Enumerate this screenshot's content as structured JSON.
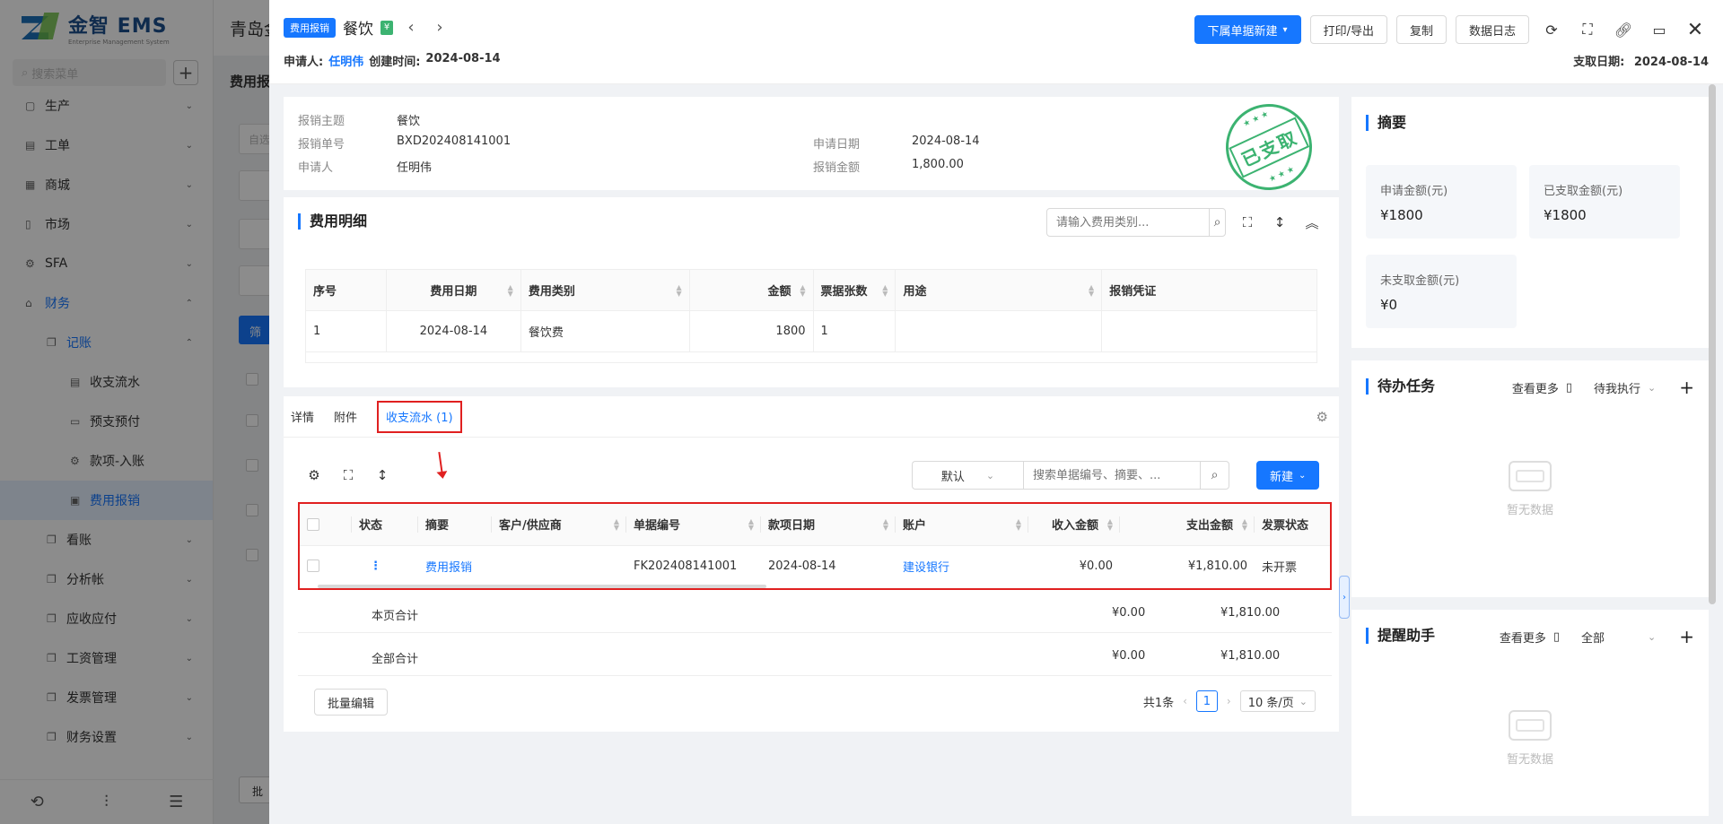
{
  "background": {
    "logo_title": "金智 EMS",
    "logo_sub": "Enterprise Management System",
    "search_placeholder": "搜索菜单",
    "header_text": "青岛金",
    "main_title": "费用报",
    "filter_btn": "筛",
    "batch_btn": "批",
    "select_placeholder": "自选",
    "nav": [
      {
        "label": "生产"
      },
      {
        "label": "工单"
      },
      {
        "label": "商城"
      },
      {
        "label": "市场"
      },
      {
        "label": "SFA"
      },
      {
        "label": "财务"
      },
      {
        "label": "记账"
      },
      {
        "label": "收支流水"
      },
      {
        "label": "预支预付"
      },
      {
        "label": "款项-入账"
      },
      {
        "label": "费用报销"
      },
      {
        "label": "看账"
      },
      {
        "label": "分析帐"
      },
      {
        "label": "应收应付"
      },
      {
        "label": "工资管理"
      },
      {
        "label": "发票管理"
      },
      {
        "label": "财务设置"
      }
    ]
  },
  "header": {
    "doc_type_tag": "费用报销",
    "title": "餐饮",
    "green_tag": "¥",
    "applicant_label": "申请人:",
    "applicant": "任明伟",
    "created_label": "创建时间:",
    "created": "2024-08-14",
    "pay_date_label": "支取日期:",
    "pay_date": "2024-08-14",
    "buttons": {
      "new_sub": "下属单据新建",
      "print": "打印/导出",
      "copy": "复制",
      "log": "数据日志"
    }
  },
  "info": {
    "subject_label": "报销主题",
    "subject": "餐饮",
    "no_label": "报销单号",
    "no": "BXD202408141001",
    "applicant_label": "申请人",
    "applicant": "任明伟",
    "apply_date_label": "申请日期",
    "apply_date": "2024-08-14",
    "amount_label": "报销金额",
    "amount": "1,800.00",
    "stamp": "已支取"
  },
  "detail": {
    "title": "费用明细",
    "search_placeholder": "请输入费用类别...",
    "columns": [
      "序号",
      "费用日期",
      "费用类别",
      "金额",
      "票据张数",
      "用途",
      "报销凭证"
    ],
    "rows": [
      {
        "seq": "1",
        "date": "2024-08-14",
        "category": "餐饮费",
        "amount": "1800",
        "count": "1",
        "purpose": "",
        "voucher": ""
      }
    ]
  },
  "flow": {
    "tabs": [
      "详情",
      "附件",
      "收支流水 (1)"
    ],
    "select_value": "默认",
    "search_placeholder": "搜索单据编号、摘要、...",
    "new_btn": "新建",
    "columns": [
      "状态",
      "摘要",
      "客户/供应商",
      "单据编号",
      "款项日期",
      "账户",
      "收入金额",
      "支出金额",
      "发票状态"
    ],
    "rows": [
      {
        "status": "⋮",
        "summary": "费用报销",
        "party": "",
        "doc_no": "FK202408141001",
        "date": "2024-08-14",
        "account": "建设银行",
        "income": "¥0.00",
        "expense": "¥1,810.00",
        "invoice": "未开票"
      }
    ],
    "page_total_label": "本页合计",
    "page_income": "¥0.00",
    "page_expense": "¥1,810.00",
    "all_total_label": "全部合计",
    "all_income": "¥0.00",
    "all_expense": "¥1,810.00",
    "batch_edit": "批量编辑",
    "total_count": "共1条",
    "page": "1",
    "page_size": "10 条/页"
  },
  "summary": {
    "title": "摘要",
    "apply_label": "申请金额(元)",
    "apply": "¥1800",
    "paid_label": "已支取金额(元)",
    "paid": "¥1800",
    "unpaid_label": "未支取金额(元)",
    "unpaid": "¥0"
  },
  "todo": {
    "title": "待办任务",
    "more": "查看更多",
    "filter": "待我执行",
    "empty": "暂无数据"
  },
  "reminder": {
    "title": "提醒助手",
    "more": "查看更多",
    "filter": "全部",
    "empty": "暂无数据"
  }
}
